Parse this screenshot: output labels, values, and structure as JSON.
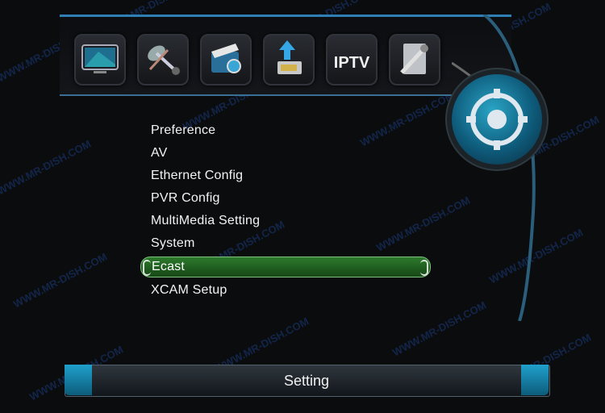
{
  "menu": {
    "items": [
      {
        "label": "Preference"
      },
      {
        "label": "AV"
      },
      {
        "label": "Ethernet Config"
      },
      {
        "label": "PVR Config"
      },
      {
        "label": "MultiMedia Setting"
      },
      {
        "label": "System"
      },
      {
        "label": "Ecast",
        "selected": true
      },
      {
        "label": "XCAM Setup"
      }
    ]
  },
  "topbar": {
    "icons": [
      {
        "name": "tv-icon"
      },
      {
        "name": "satellite-tools-icon"
      },
      {
        "name": "media-clapper-icon"
      },
      {
        "name": "usb-upgrade-icon"
      },
      {
        "name": "iptv-icon",
        "label": "IPTV"
      },
      {
        "name": "tools-icon"
      }
    ]
  },
  "footer": {
    "title": "Setting"
  },
  "watermark": {
    "text": "WWW.MR-DISH.COM"
  },
  "colors": {
    "accent_blue": "#2f7fb5",
    "selection_green": "#2d7a2d",
    "background": "#0b0c0e"
  }
}
